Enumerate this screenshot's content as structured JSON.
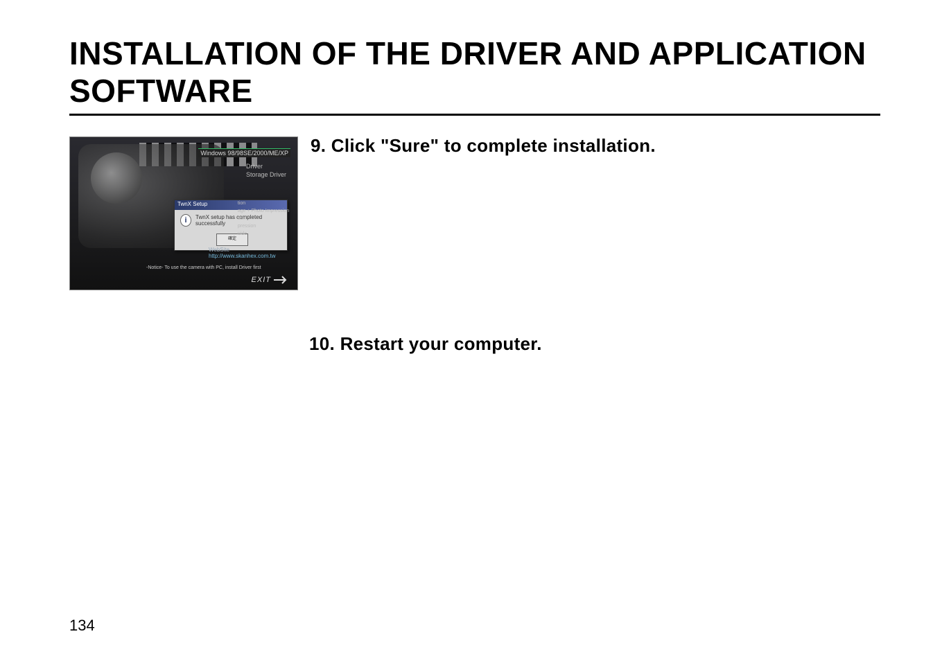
{
  "heading": "INSTALLATION OF THE DRIVER AND APPLICATION SOFTWARE",
  "steps": {
    "s9": "9. Click \"Sure\" to complete installation.",
    "s10": "10. Restart your computer."
  },
  "screenshot": {
    "os_line": "Windows 98/98SE/2000/ME/XP",
    "driver_lines": [
      "Driver",
      "Storage Driver"
    ],
    "modal": {
      "title": "TwnX Setup",
      "message": "TwnX setup has completed successfully",
      "button": "確定"
    },
    "right_items": [
      "tion",
      "age + Photo Impression",
      "tion",
      "pression",
      "uide"
    ],
    "website_label": "WebSite",
    "website_url": "http://www.skanhex.com.tw",
    "notice": "-Notice- To use the camera with PC, install Driver first",
    "exit": "EXIT"
  },
  "page_number": "134"
}
